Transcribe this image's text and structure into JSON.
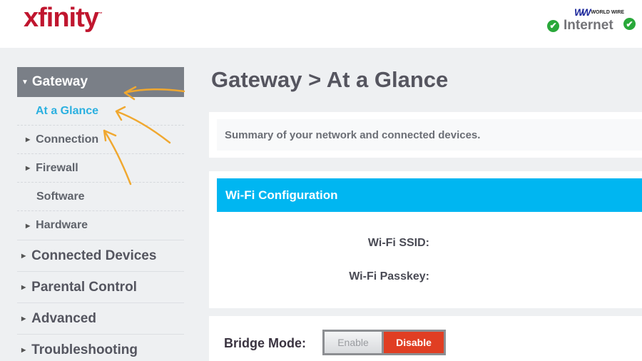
{
  "header": {
    "logo_text": "xfinity",
    "logo_tm": "™",
    "watermark_mark": "WW",
    "watermark_text": "WORLD WIRE",
    "status_items": [
      {
        "label": "Internet",
        "state": "ok",
        "icon": "check-circle-icon"
      },
      {
        "label": "",
        "state": "ok",
        "icon": "check-circle-icon"
      }
    ]
  },
  "sidebar": {
    "section": {
      "label": "Gateway",
      "expanded": true
    },
    "sub_items": [
      {
        "label": "At a Glance",
        "active": true,
        "has_caret": false
      },
      {
        "label": "Connection",
        "active": false,
        "has_caret": true
      },
      {
        "label": "Firewall",
        "active": false,
        "has_caret": true
      },
      {
        "label": "Software",
        "active": false,
        "has_caret": false
      },
      {
        "label": "Hardware",
        "active": false,
        "has_caret": true
      }
    ],
    "top_items": [
      {
        "label": "Connected Devices"
      },
      {
        "label": "Parental Control"
      },
      {
        "label": "Advanced"
      },
      {
        "label": "Troubleshooting"
      }
    ]
  },
  "main": {
    "title": "Gateway > At a Glance",
    "summary": "Summary of your network and connected devices.",
    "wifi": {
      "header": "Wi-Fi Configuration",
      "ssid_label": "Wi-Fi SSID:",
      "ssid_value": "",
      "passkey_label": "Wi-Fi Passkey:",
      "passkey_value": ""
    },
    "bridge_mode": {
      "label": "Bridge Mode:",
      "enable_label": "Enable",
      "disable_label": "Disable",
      "selected": "Disable"
    }
  },
  "colors": {
    "brand": "#c0162f",
    "accent": "#00b6f1",
    "active_link": "#2bb0e0",
    "disable_button": "#e03e23",
    "status_ok": "#29a83a",
    "annotation_arrow": "#f0a830"
  }
}
